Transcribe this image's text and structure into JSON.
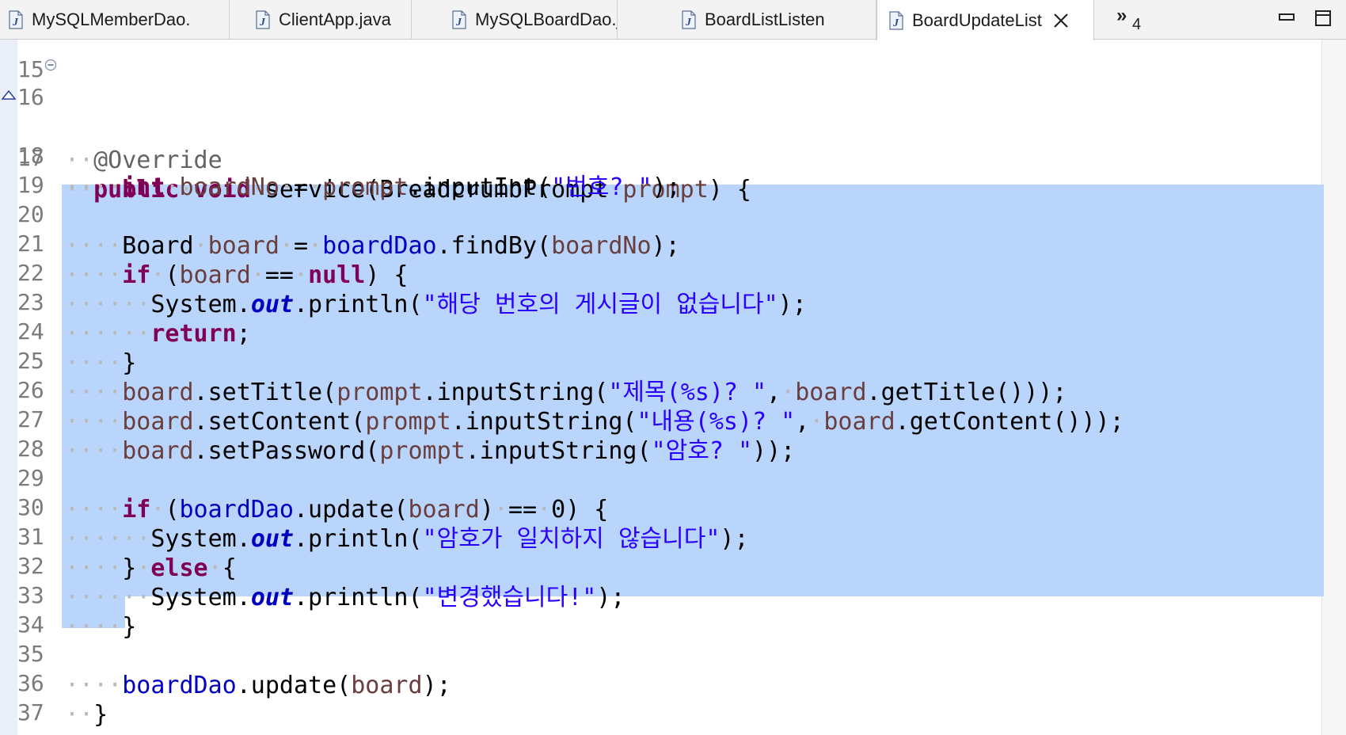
{
  "tabs": [
    {
      "label": "MySQLMemberDao.",
      "active": false
    },
    {
      "label": "ClientApp.java",
      "active": false
    },
    {
      "label": "MySQLBoardDao.j",
      "active": false
    },
    {
      "label": "BoardListListen",
      "active": false
    },
    {
      "label": "BoardUpdateList",
      "active": true
    }
  ],
  "tab_overflow": {
    "chevron": "»",
    "count": "4"
  },
  "colors": {
    "keyword": "#7f0055",
    "string": "#2a00ff",
    "field": "#0000c0",
    "local_var": "#6a3e3e",
    "selection": "#b9d5fb",
    "line_number": "#7b7b7b"
  },
  "editor": {
    "lines": [
      {
        "num": "15"
      },
      {
        "num": "16"
      },
      {
        "num": "17"
      },
      {
        "num": "18"
      },
      {
        "num": "19"
      },
      {
        "num": "20"
      },
      {
        "num": "21"
      },
      {
        "num": "22"
      },
      {
        "num": "23"
      },
      {
        "num": "24"
      },
      {
        "num": "25"
      },
      {
        "num": "26"
      },
      {
        "num": "27"
      },
      {
        "num": "28"
      },
      {
        "num": "29"
      },
      {
        "num": "30"
      },
      {
        "num": "31"
      },
      {
        "num": "32"
      },
      {
        "num": "33"
      },
      {
        "num": "34"
      },
      {
        "num": "35"
      },
      {
        "num": "36"
      },
      {
        "num": "37"
      }
    ],
    "tokens": {
      "override": "@Override",
      "public": "public",
      "void": "void",
      "service_sig": "service(BreadcrumbPrompt",
      "prompt": "prompt",
      "brace_open": ") {",
      "int": "int",
      "boardNo": "boardNo",
      "eq": "=",
      "inputInt": ".inputInt(",
      "str_bunho": "\"번호? \"",
      "end_paren": ");",
      "Board": "Board",
      "board": "board",
      "boardDao": "boardDao",
      "findBy": ".findBy(",
      "if": "if",
      "paren_open": "(",
      "eqeq": "==",
      "null": "null",
      "system": "System.",
      "out": "out",
      "println": ".println(",
      "str_notfound": "\"해당 번호의 게시글이 없습니다\"",
      "return": "return",
      "semicolon": ";",
      "close_brace": "}",
      "setTitle": ".setTitle(",
      "inputString": ".inputString(",
      "str_title": "\"제목(%s)? \"",
      "getTitle": ".getTitle()));",
      "setContent": ".setContent(",
      "str_content": "\"내용(%s)? \"",
      "getContent": ".getContent()));",
      "setPassword": ".setPassword(",
      "str_pw": "\"암호? \"",
      "pw_end": "));",
      "update": ".update(",
      "zero": "0",
      "paren_close_brace": ") {",
      "str_mismatch": "\"암호가 일치하지 않습니다\"",
      "else": "else",
      "str_changed": "\"변경했습니다!\"",
      "comma": ","
    }
  }
}
